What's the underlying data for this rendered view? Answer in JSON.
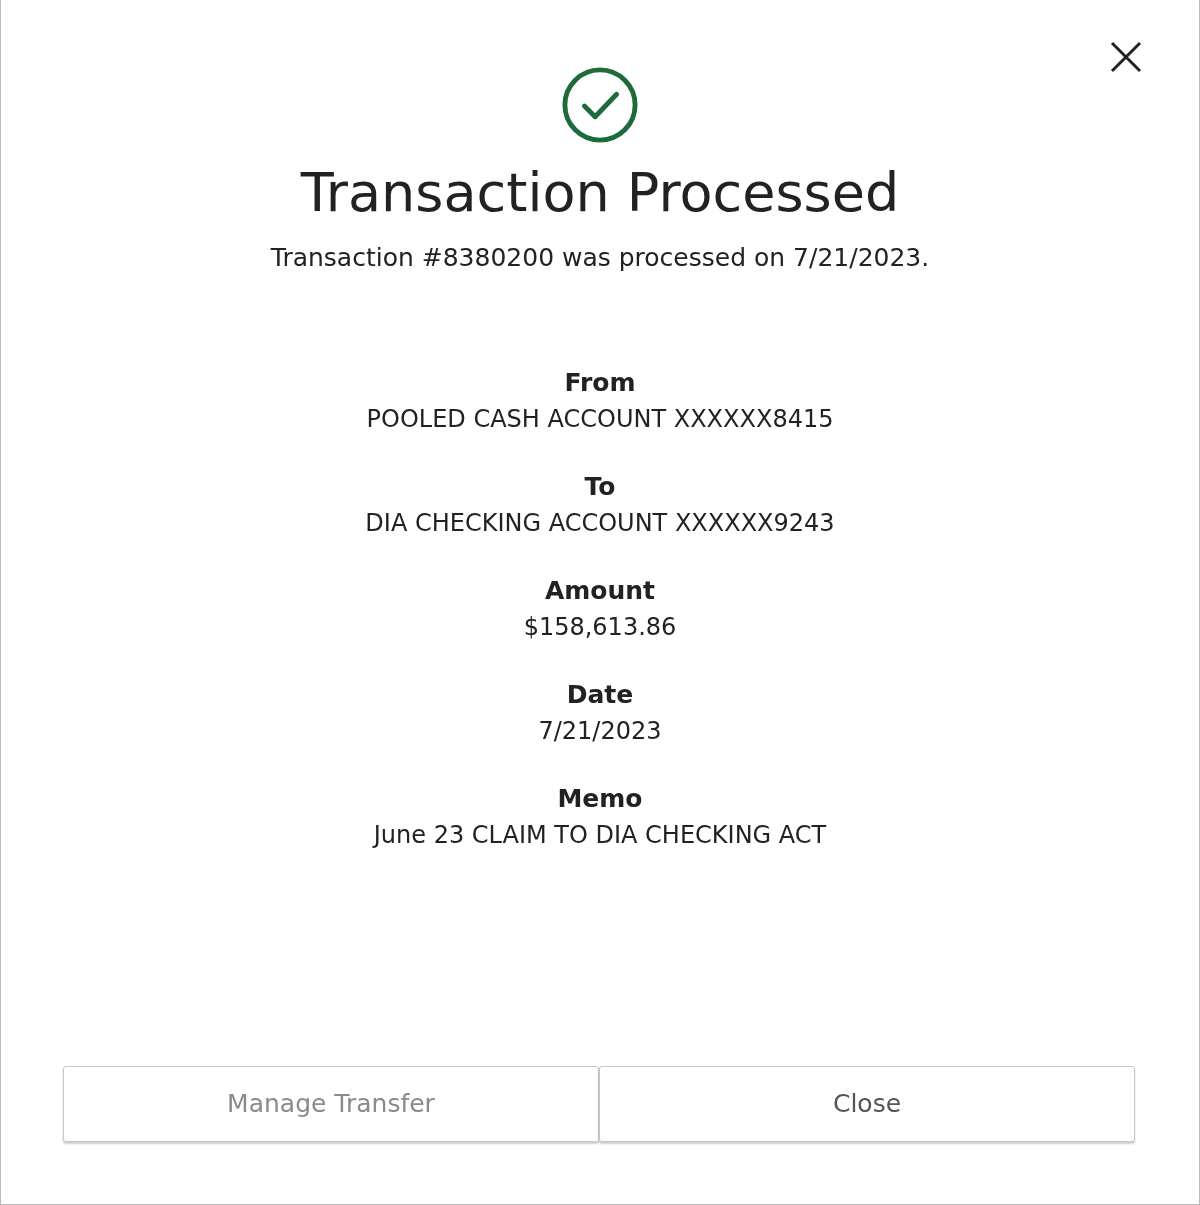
{
  "dialog": {
    "title": "Transaction Processed",
    "message": "Transaction #8380200 was processed on 7/21/2023.",
    "details": [
      {
        "label": "From",
        "value": "POOLED CASH ACCOUNT XXXXXX8415"
      },
      {
        "label": "To",
        "value": "DIA CHECKING ACCOUNT XXXXXX9243"
      },
      {
        "label": "Amount",
        "value": "$158,613.86"
      },
      {
        "label": "Date",
        "value": "7/21/2023"
      },
      {
        "label": "Memo",
        "value": "June 23 CLAIM TO DIA CHECKING ACT"
      }
    ],
    "buttons": [
      "Manage Transfer",
      "Close"
    ]
  }
}
